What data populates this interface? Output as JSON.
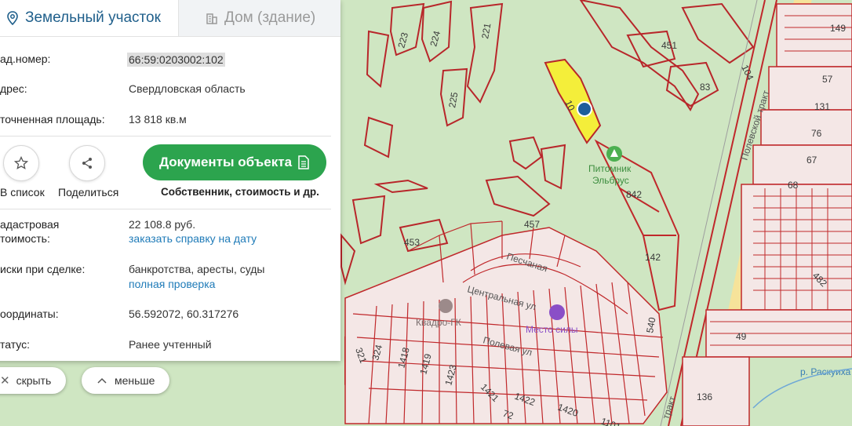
{
  "tabs": {
    "land": "Земельный участок",
    "house": "Дом (здание)"
  },
  "info": {
    "cad_label": "ад.номер:",
    "cad_value": "66:59:0203002:102",
    "addr_label": "дрес:",
    "addr_value": "Свердловская область",
    "area_label": "точненная площадь:",
    "area_value": "13 818 кв.м"
  },
  "actions": {
    "list": "В список",
    "share": "Поделиться",
    "docs": "Документы объекта",
    "docs_sub": "Собственник, стоимость и др."
  },
  "details": {
    "cost_label_1": "адастровая",
    "cost_label_2": "тоимость:",
    "cost_value": "22 108.8 руб.",
    "cost_link": "заказать справку на дату",
    "risk_label": "иски при сделке:",
    "risk_value": "банкротства, аресты, суды",
    "risk_link": "полная проверка",
    "coord_label": "оординаты:",
    "coord_value": "56.592072, 60.317276",
    "status_label": "татус:",
    "status_value": "Ранее учтенный"
  },
  "controls": {
    "hide": "скрыть",
    "less": "меньше"
  },
  "map": {
    "parcel_labels": [
      "223",
      "224",
      "221",
      "225",
      "451",
      "104",
      "83",
      "149",
      "57",
      "131",
      "76",
      "67",
      "68",
      "842",
      "142",
      "457",
      "453",
      "321",
      "324",
      "1418",
      "1419",
      "1423",
      "1421",
      "1422",
      "1420",
      "1101",
      "72",
      "540",
      "482",
      "49",
      "136",
      "10"
    ],
    "poi": {
      "nursery_1": "Питомник",
      "nursery_2": "Эльбрус",
      "kvadro": "Квадро-ГК",
      "mesto": "Место силы"
    },
    "streets": {
      "polevskoy": "Полевской тракт",
      "pesch": "Песчаная",
      "tsentr": "Центральная ул",
      "polev_ul": "Полевая ул",
      "trakt": "тракт",
      "river": "р. Раскуиха"
    },
    "colors": {
      "parcel_line": "#c0282b",
      "forest": "#cfe6c2",
      "selected": "#f4ee3a",
      "marker": "#1c5d9b",
      "green_btn": "#2ca44e"
    }
  }
}
